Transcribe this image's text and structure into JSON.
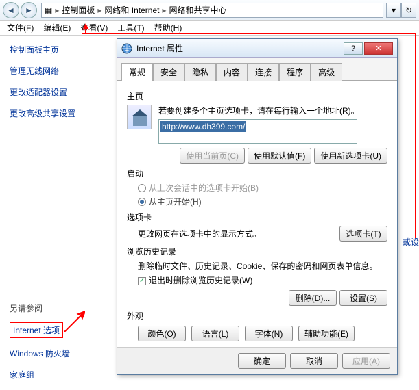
{
  "topnav": {
    "crumbs": [
      "控制面板",
      "网络和 Internet",
      "网络和共享中心"
    ]
  },
  "menubar": {
    "items": [
      "文件(F)",
      "编辑(E)",
      "查看(V)",
      "工具(T)",
      "帮助(H)"
    ]
  },
  "leftpanel": {
    "home": "控制面板主页",
    "links": [
      "管理无线网络",
      "更改适配器设置",
      "更改高级共享设置"
    ],
    "see_also_hdr": "另请参阅",
    "see_also": [
      "Internet 选项",
      "Windows 防火墙",
      "家庭组"
    ]
  },
  "right_partial": "或设",
  "dialog": {
    "title": "Internet 属性",
    "tabs": [
      "常规",
      "安全",
      "隐私",
      "内容",
      "连接",
      "程序",
      "高级"
    ],
    "homepage": {
      "label": "主页",
      "desc": "若要创建多个主页选项卡，请在每行输入一个地址(R)。",
      "url": "http://www.dh399.com/",
      "btn_current": "使用当前页(C)",
      "btn_default": "使用默认值(F)",
      "btn_newtab": "使用新选项卡(U)"
    },
    "startup": {
      "label": "启动",
      "opt_last": "从上次会话中的选项卡开始(B)",
      "opt_home": "从主页开始(H)"
    },
    "tabs_section": {
      "label": "选项卡",
      "desc": "更改网页在选项卡中的显示方式。",
      "btn": "选项卡(T)"
    },
    "history": {
      "label": "浏览历史记录",
      "desc": "删除临时文件、历史记录、Cookie、保存的密码和网页表单信息。",
      "chk": "退出时删除浏览历史记录(W)",
      "btn_delete": "删除(D)...",
      "btn_settings": "设置(S)"
    },
    "appearance": {
      "label": "外观",
      "btn_color": "颜色(O)",
      "btn_lang": "语言(L)",
      "btn_font": "字体(N)",
      "btn_access": "辅助功能(E)"
    },
    "footer": {
      "ok": "确定",
      "cancel": "取消",
      "apply": "应用(A)"
    }
  }
}
